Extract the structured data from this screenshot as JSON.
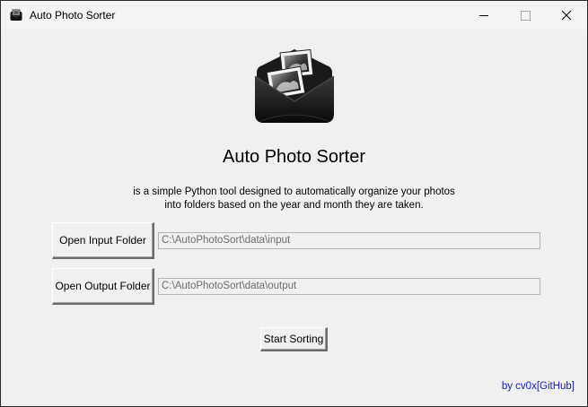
{
  "window": {
    "title": "Auto Photo Sorter"
  },
  "main": {
    "app_title": "Auto Photo Sorter",
    "description_line1": "is a simple Python tool designed to automatically organize your photos",
    "description_line2": "into folders based on the year and month they are taken."
  },
  "input": {
    "button_label": "Open Input Folder",
    "path": "C:\\AutoPhotoSort\\data\\input"
  },
  "output": {
    "button_label": "Open Output Folder",
    "path": "C:\\AutoPhotoSort\\data\\output"
  },
  "actions": {
    "start_label": "Start Sorting"
  },
  "footer": {
    "credit": "by cv0x[GitHub]"
  },
  "icons": {
    "app": "photo-envelope-icon",
    "logo": "photo-envelope-logo",
    "minimize": "minimize-icon",
    "maximize": "maximize-icon",
    "close": "close-icon"
  },
  "colors": {
    "background": "#f0f0f0",
    "credit_link": "#1a1ab8",
    "field_text": "#6d6d6d"
  }
}
